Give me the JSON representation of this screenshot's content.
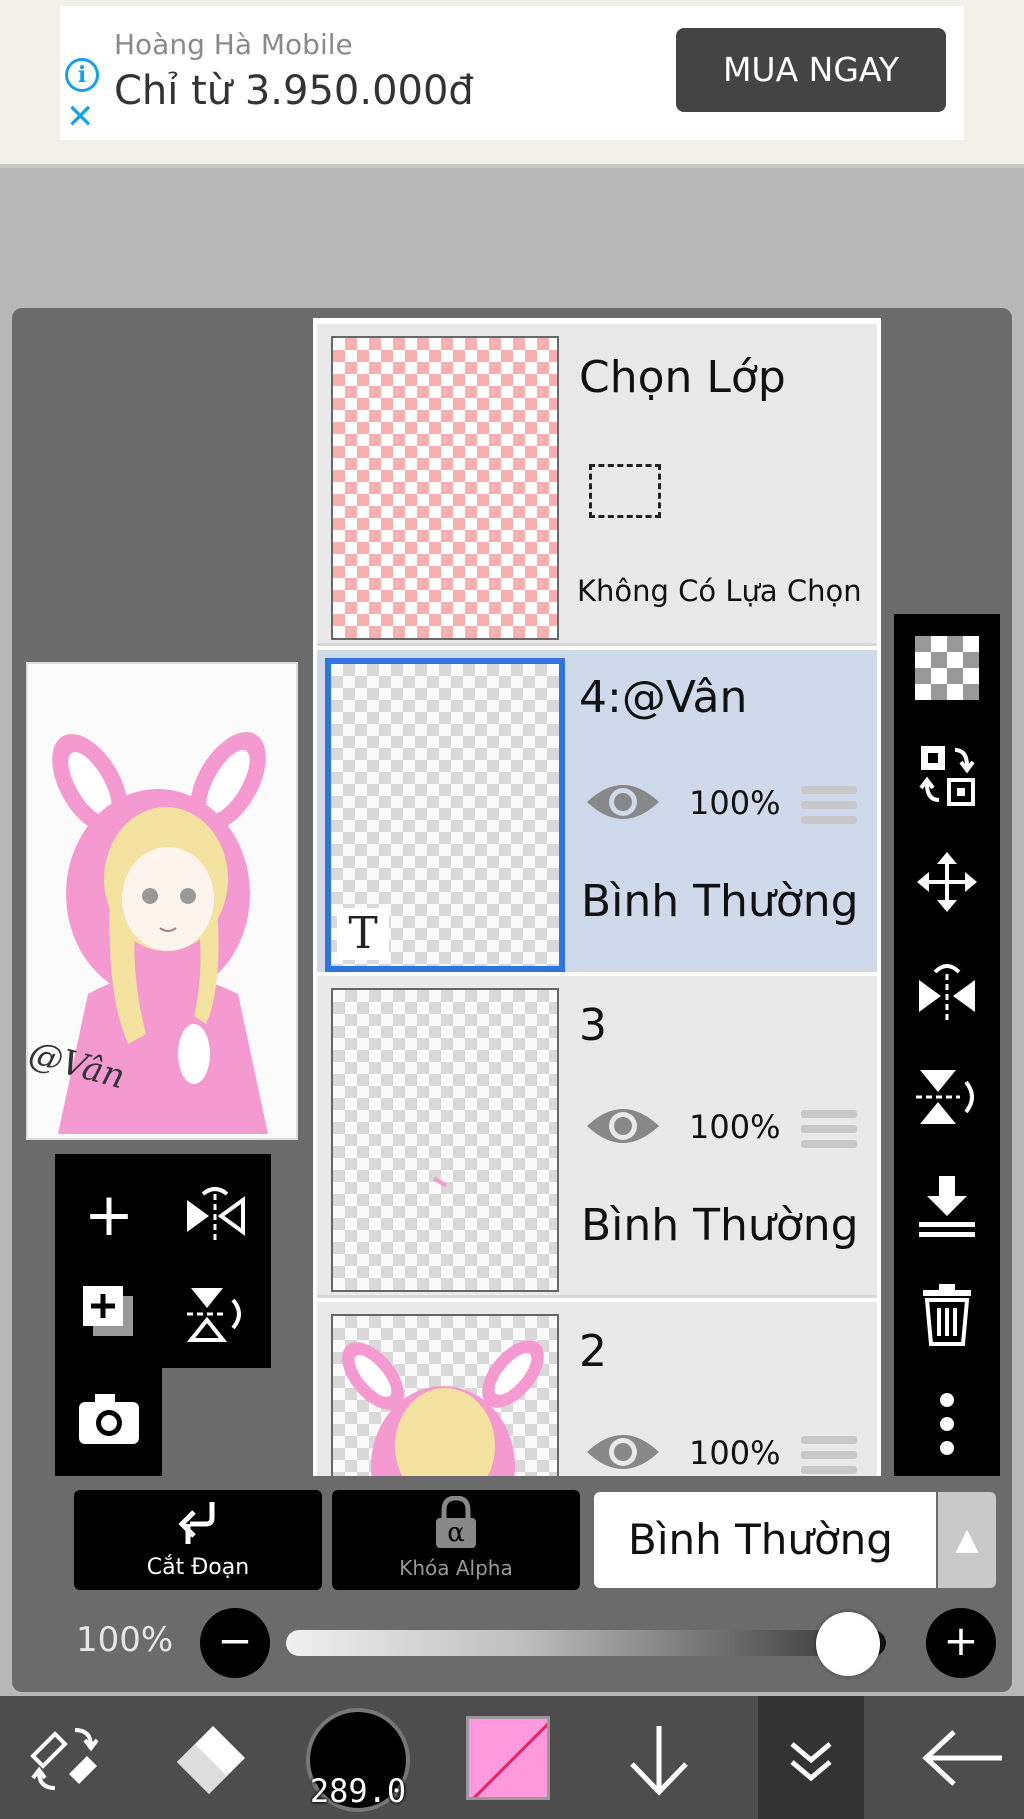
{
  "ad": {
    "brand": "Hoàng Hà Mobile",
    "headline": "Chỉ từ 3.950.000đ",
    "cta": "MUA NGAY",
    "info_icon": "info-icon",
    "close_icon": "close-icon"
  },
  "preview": {
    "watermark": "@Vân"
  },
  "layers": [
    {
      "name": "Chọn Lớp",
      "subtitle": "Không Có Lựa Chọn",
      "type": "selection"
    },
    {
      "name": "4:@Vân",
      "opacity": "100%",
      "blend": "Bình Thường",
      "selected": true,
      "text_marker": "T"
    },
    {
      "name": "3",
      "opacity": "100%",
      "blend": "Bình Thường"
    },
    {
      "name": "2",
      "opacity": "100%"
    }
  ],
  "right_toolbar": [
    "transparent-icon",
    "swap-icon",
    "move-icon",
    "flip-horizontal-icon",
    "flip-vertical-icon",
    "merge-down-icon",
    "trash-icon",
    "more-icon"
  ],
  "left_tools": [
    "add-layer-icon",
    "flip-h-icon",
    "add-copy-icon",
    "flip-v-icon",
    "camera-icon"
  ],
  "controls": {
    "clip_label": "Cắt Đoạn",
    "alpha_lock_label": "Khóa Alpha",
    "alpha_symbol": "α",
    "blend_mode": "Bình Thường",
    "opacity_label": "100%",
    "opacity_value": 1.0
  },
  "bottom_bar": {
    "brush_size": "289.0",
    "color": "#ff99dd"
  }
}
